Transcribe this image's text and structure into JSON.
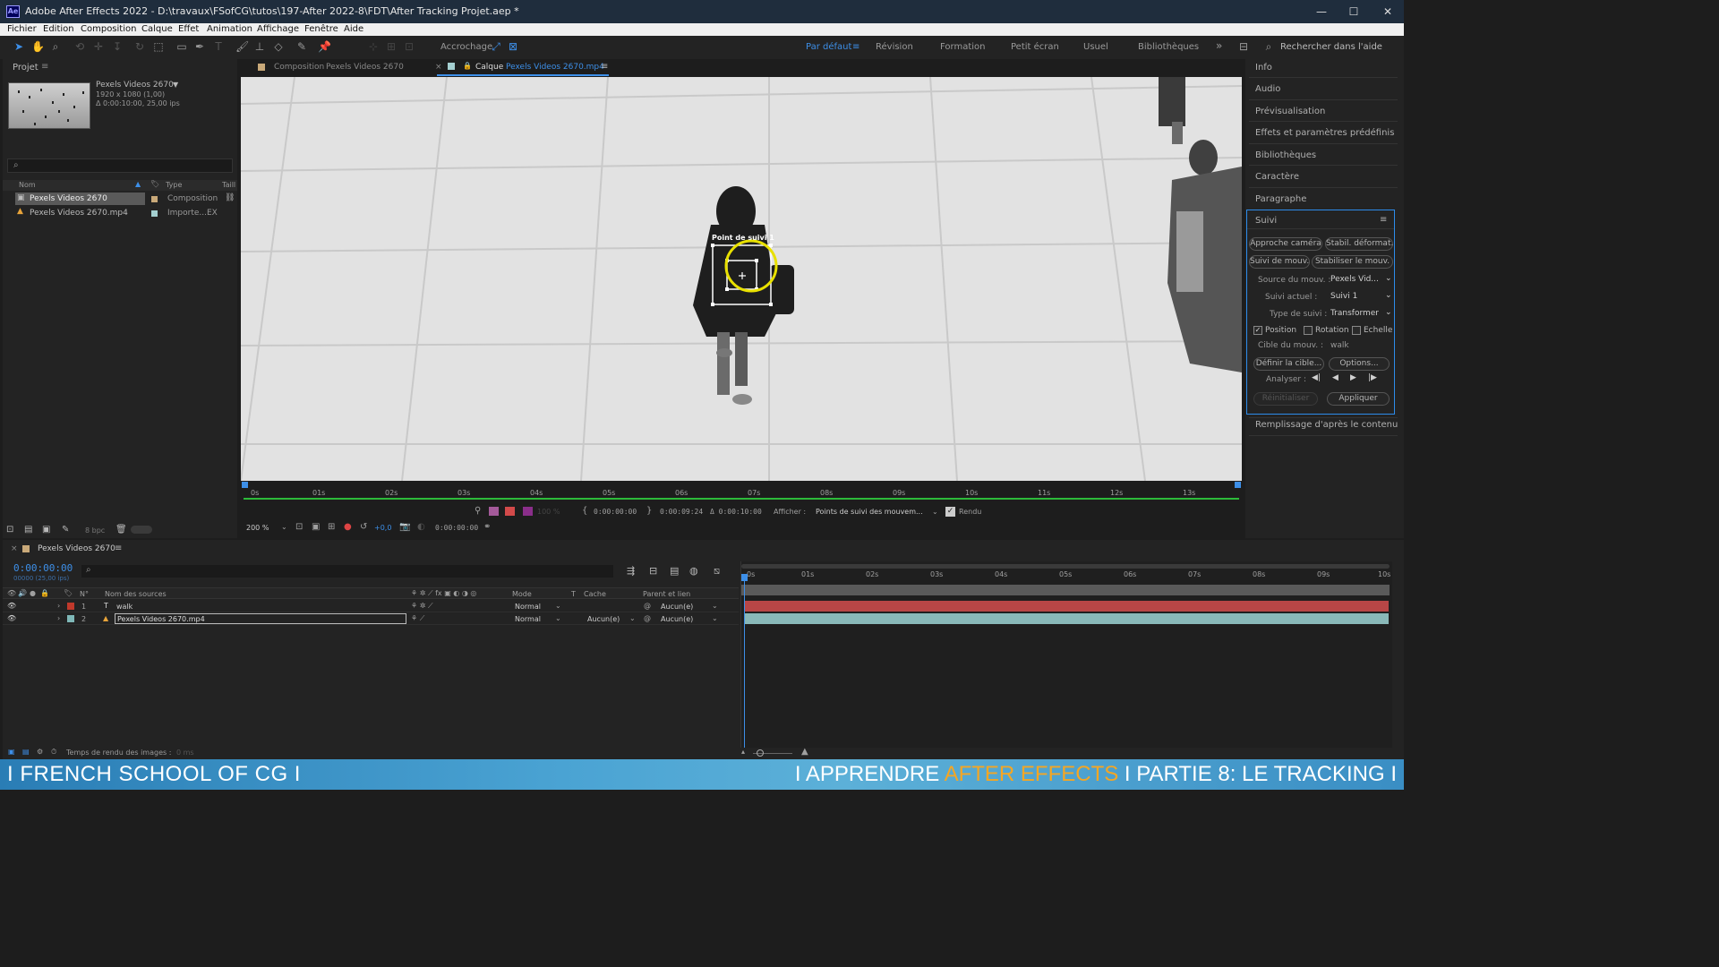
{
  "window": {
    "app_icon": "Ae",
    "title": "Adobe After Effects 2022 - D:\\travaux\\FSofCG\\tutos\\197-After 2022-8\\FDT\\After Tracking Projet.aep *",
    "controls": [
      "—",
      "☐",
      "✕"
    ]
  },
  "menu": [
    "Fichier",
    "Edition",
    "Composition",
    "Calque",
    "Effet",
    "Animation",
    "Affichage",
    "Fenêtre",
    "Aide"
  ],
  "toolbar": {
    "snap_label": "Accrochage",
    "workspaces": [
      "Par défaut",
      "Révision",
      "Formation",
      "Petit écran",
      "Usuel",
      "Bibliothèques"
    ],
    "active_workspace": "Par défaut",
    "overflow": "»",
    "search_placeholder": "Rechercher dans l'aide"
  },
  "project": {
    "tab": "Projet",
    "item_name": "Pexels Videos 2670",
    "item_res": "1920 x 1080 (1,00)",
    "item_dur": "Δ 0:00:10:00, 25,00 ips",
    "cols": [
      "Nom",
      "Type",
      "Taill"
    ],
    "rows": [
      {
        "name": "Pexels Videos 2670",
        "type": "Composition"
      },
      {
        "name": "Pexels Videos 2670.mp4",
        "type": "Importe...EX"
      }
    ],
    "bpc": "8 bpc"
  },
  "viewer": {
    "tab_comp_label": "Composition",
    "tab_comp_name": "Pexels Videos 2670",
    "tab_layer_label": "Calque",
    "tab_layer_name": "Pexels Videos 2670.mp4",
    "track_point_label": "Point de suivi 1",
    "ruler": [
      "0s",
      "01s",
      "02s",
      "03s",
      "04s",
      "05s",
      "06s",
      "07s",
      "08s",
      "09s",
      "10s",
      "11s",
      "12s",
      "13s"
    ],
    "opacity": "100 %",
    "in_time": "0:00:00:00",
    "out_time": "0:00:09:24",
    "duration": "Δ 0:00:10:00",
    "show_label": "Afficher :",
    "show_value": "Points de suivi des mouvem...",
    "render_label": "Rendu",
    "zoom": "200 %",
    "exposure": "+0,0",
    "current_time": "0:00:00:00"
  },
  "right": {
    "panels": [
      "Info",
      "Audio",
      "Prévisualisation",
      "Effets et paramètres prédéfinis",
      "Bibliothèques",
      "Caractère",
      "Paragraphe"
    ],
    "tracker": {
      "title": "Suivi",
      "btn_camera": "Approche caméra",
      "btn_warp": "Stabil. déformat.",
      "btn_track": "Suivi de mouv.",
      "btn_stabilize": "Stabiliser le mouv.",
      "source_label": "Source du mouv. :",
      "source_value": "Pexels Vid...",
      "current_label": "Suivi actuel :",
      "current_value": "Suivi 1",
      "type_label": "Type de suivi :",
      "type_value": "Transformer",
      "position": "Position",
      "rotation": "Rotation",
      "scale": "Echelle",
      "target_label": "Cible du mouv. :",
      "target_value": "walk",
      "btn_target": "Définir la cible...",
      "btn_options": "Options...",
      "analyze_label": "Analyser :",
      "btn_reset": "Réinitialiser",
      "btn_apply": "Appliquer"
    },
    "content_fill": "Remplissage d'après le contenu"
  },
  "timeline": {
    "tab": "Pexels Videos 2670",
    "time": "0:00:00:00",
    "fps": "00000 (25,00 ips)",
    "cols": {
      "num": "N°",
      "source": "Nom des sources",
      "mode": "Mode",
      "t": "T",
      "matte": "Cache",
      "parent": "Parent et lien"
    },
    "layers": [
      {
        "num": "1",
        "type": "T",
        "name": "walk",
        "mode": "Normal",
        "matte": "",
        "parent": "Aucun(e)",
        "color": "#c0392b"
      },
      {
        "num": "2",
        "type": "",
        "name": "Pexels Videos 2670.mp4",
        "mode": "Normal",
        "matte": "Aucun(e)",
        "parent": "Aucun(e)",
        "color": "#7fb8b8"
      }
    ],
    "ruler": [
      "0s",
      "01s",
      "02s",
      "03s",
      "04s",
      "05s",
      "06s",
      "07s",
      "08s",
      "09s",
      "10s"
    ],
    "render_time_label": "Temps de rendu des images :",
    "render_time_value": "0 ms"
  },
  "banner": {
    "left": "I FRENCH SCHOOL OF CG I",
    "right_a": "I APPRENDRE ",
    "right_b": "AFTER EFFECTS",
    "right_c": " I PARTIE 8: LE TRACKING I"
  },
  "colors": {
    "accent": "#2d8ceb",
    "banner_highlight": "#f5a623",
    "track_circle": "#e8e000"
  }
}
